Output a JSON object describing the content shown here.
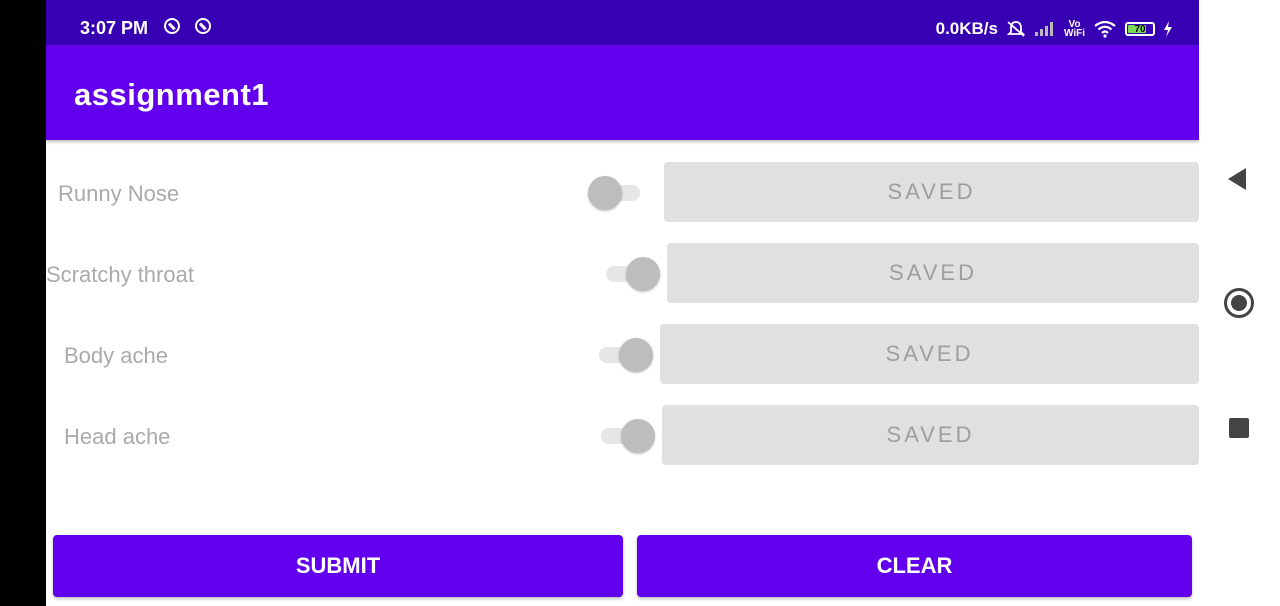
{
  "status_bar": {
    "time": "3:07 PM",
    "network_speed": "0.0KB/s",
    "vo_top": "Vo",
    "vo_bottom": "WiFi",
    "battery": "70",
    "icons": [
      "notification-icon",
      "notification-icon",
      "mute-icon",
      "signal-icon",
      "wifi-icon",
      "battery-icon",
      "charging-icon"
    ]
  },
  "app_bar": {
    "title": "assignment1"
  },
  "symptoms": [
    {
      "label": "Runny  Nose",
      "switch_on": false,
      "button_label": "SAVED"
    },
    {
      "label": "Scratchy throat",
      "switch_on": true,
      "button_label": "SAVED"
    },
    {
      "label": "Body ache",
      "switch_on": true,
      "button_label": "SAVED"
    },
    {
      "label": "Head ache",
      "switch_on": true,
      "button_label": "SAVED"
    }
  ],
  "actions": {
    "submit_label": "SUBMIT",
    "clear_label": "CLEAR"
  },
  "colors": {
    "primary": "#6200ee",
    "primary_dark": "#3700b3",
    "button_disabled": "#e0e0e0",
    "text_disabled": "#aaaaaa"
  },
  "nav_bar": {
    "icons": [
      "back-icon",
      "home-icon",
      "recents-icon"
    ]
  }
}
